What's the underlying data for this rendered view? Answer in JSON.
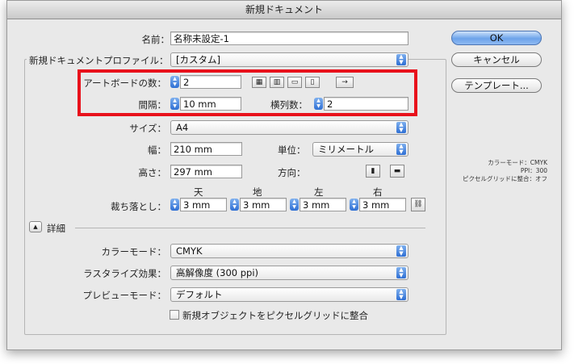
{
  "window": {
    "title": "新規ドキュメント"
  },
  "name": {
    "label": "名前：",
    "value": "名称未設定-1"
  },
  "profile": {
    "label": "新規ドキュメントプロファイル：",
    "value": "[カスタム]"
  },
  "artboards": {
    "count_label": "アートボードの数：",
    "count_value": "2",
    "spacing_label": "間隔：",
    "spacing_value": "10 mm",
    "columns_label": "横列数：",
    "columns_value": "2",
    "arrange_arrow": "→"
  },
  "size": {
    "label": "サイズ：",
    "value": "A4"
  },
  "width": {
    "label": "幅：",
    "value": "210 mm"
  },
  "height": {
    "label": "高さ：",
    "value": "297 mm"
  },
  "units": {
    "label": "単位：",
    "value": "ミリメートル"
  },
  "orientation": {
    "label": "方向："
  },
  "bleed": {
    "label": "裁ち落とし：",
    "top_label": "天",
    "bottom_label": "地",
    "left_label": "左",
    "right_label": "右",
    "top": "3 mm",
    "bottom": "3 mm",
    "left": "3 mm",
    "right": "3 mm"
  },
  "advanced": {
    "label": "詳細",
    "color_mode_label": "カラーモード：",
    "color_mode_value": "CMYK",
    "raster_label": "ラスタライズ効果：",
    "raster_value": "高解像度 (300 ppi)",
    "preview_label": "プレビューモード：",
    "preview_value": "デフォルト",
    "align_pixel_label": "新規オブジェクトをピクセルグリッドに整合",
    "align_pixel_checked": false
  },
  "buttons": {
    "ok": "OK",
    "cancel": "キャンセル",
    "templates": "テンプレート..."
  },
  "info": {
    "color_mode": "カラーモード：CMYK",
    "ppi": "PPI：300",
    "align": "ピクセルグリッドに整合：オフ"
  }
}
